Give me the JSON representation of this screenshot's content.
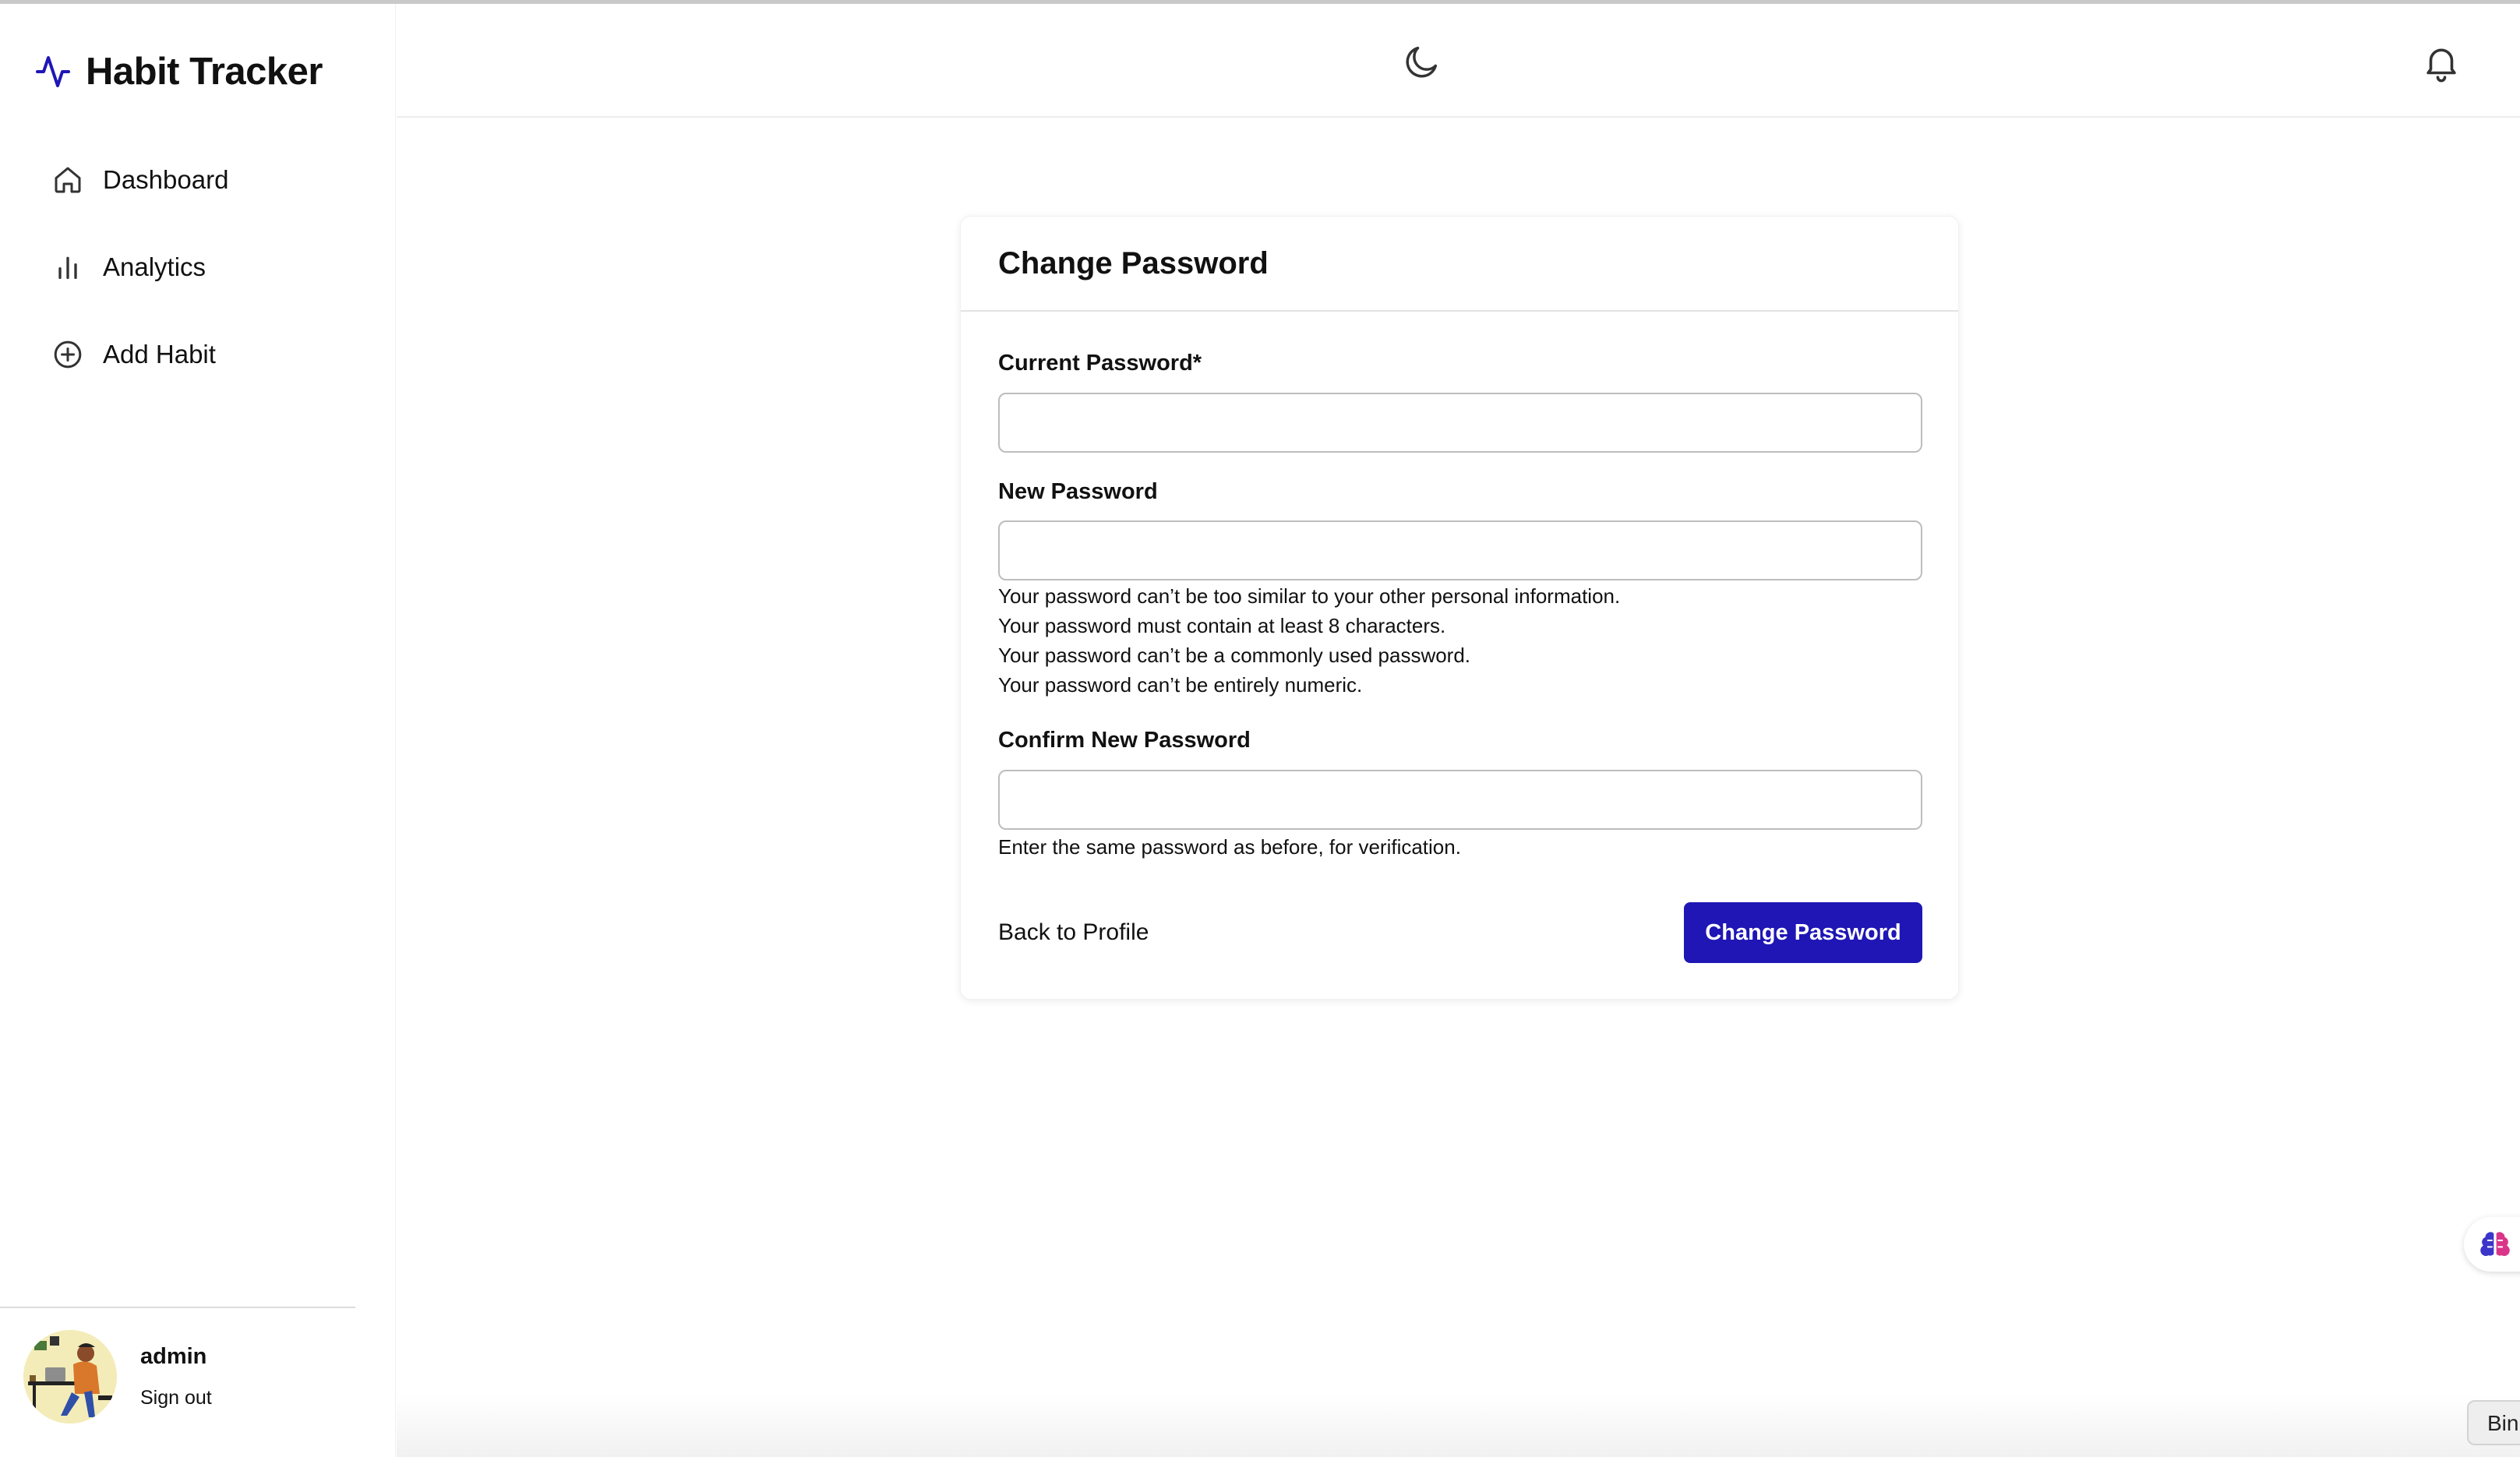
{
  "app": {
    "title": "Habit Tracker",
    "accent_color": "#1f16b5"
  },
  "sidebar": {
    "items": [
      {
        "label": "Dashboard",
        "icon": "home-icon"
      },
      {
        "label": "Analytics",
        "icon": "bar-chart-icon"
      },
      {
        "label": "Add Habit",
        "icon": "plus-circle-icon"
      }
    ],
    "user": {
      "name": "admin",
      "signout_label": "Sign out",
      "avatar_icon": "avatar-illustration"
    }
  },
  "header": {
    "theme_icon": "moon-icon",
    "notification_icon": "bell-icon"
  },
  "form": {
    "title": "Change Password",
    "current_password": {
      "label": "Current Password*",
      "value": ""
    },
    "new_password": {
      "label": "New Password",
      "value": "",
      "help": [
        "Your password can’t be too similar to your other personal information.",
        "Your password must contain at least 8 characters.",
        "Your password can’t be a commonly used password.",
        "Your password can’t be entirely numeric."
      ]
    },
    "confirm_password": {
      "label": "Confirm New Password",
      "value": "",
      "help": "Enter the same password as before, for verification."
    },
    "back_label": "Back to Profile",
    "submit_label": "Change Password"
  },
  "widgets": {
    "brain_icon": "brain-icon",
    "bin_label": "Bin"
  }
}
